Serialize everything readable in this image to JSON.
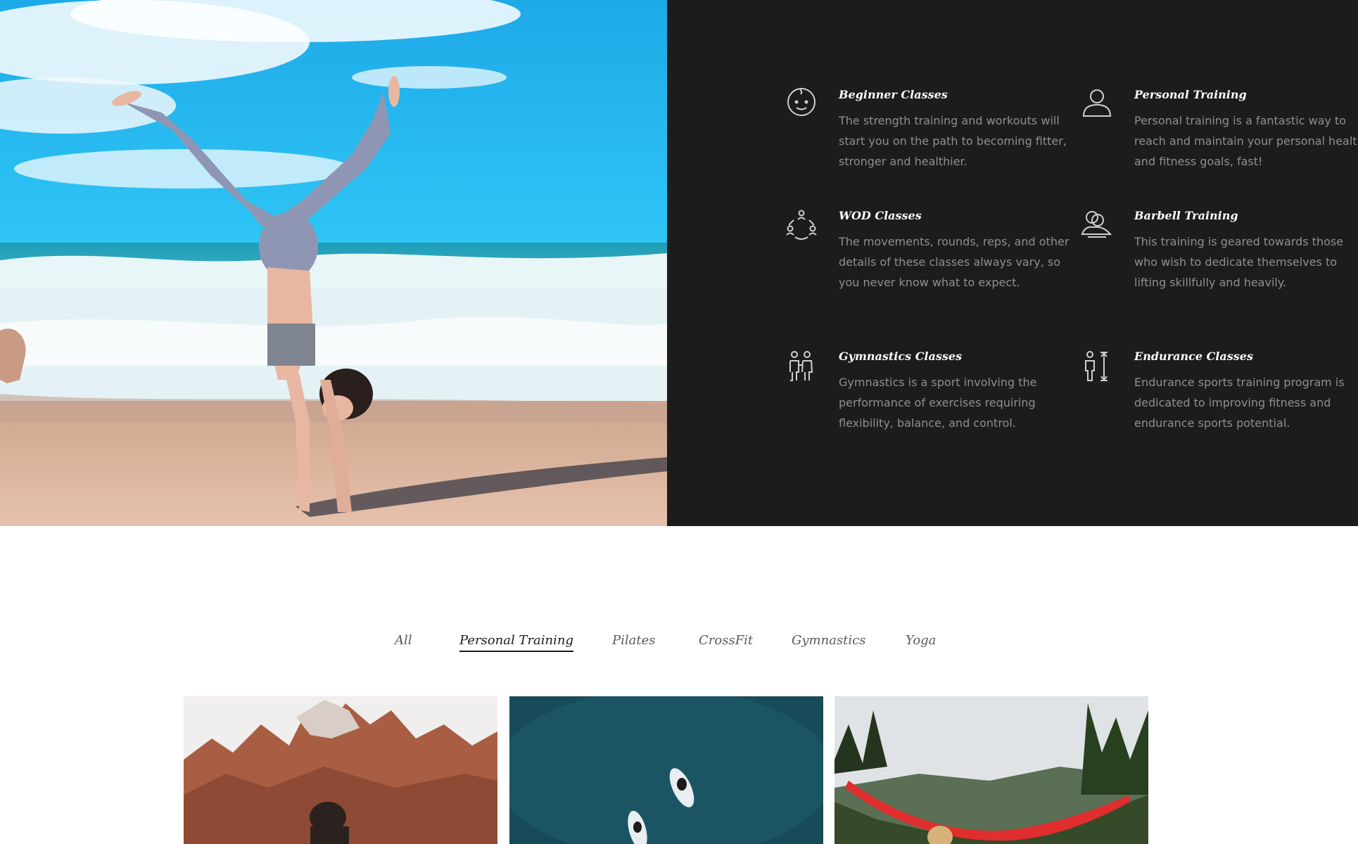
{
  "features": [
    {
      "icon": "baby-face-icon",
      "title": "Beginner Classes",
      "description": "The strength training and workouts will start you on the path to becoming fitter, stronger and healthier."
    },
    {
      "icon": "person-icon",
      "title": "Personal Training",
      "description": "Personal training is a fantastic way to reach and maintain your personal health and fitness goals, fast!"
    },
    {
      "icon": "group-circle-icon",
      "title": "WOD Classes",
      "description": "The movements, rounds, reps, and other details of these classes always vary, so you never know what to expect."
    },
    {
      "icon": "lifter-icon",
      "title": "Barbell Training",
      "description": "This training is geared towards those who wish to dedicate themselves to lifting skillfully and heavily."
    },
    {
      "icon": "gymnasts-icon",
      "title": "Gymnastics Classes",
      "description": "Gymnastics is a sport involving the performance of exercises requiring flexibility, balance, and control."
    },
    {
      "icon": "height-measure-icon",
      "title": "Endurance Classes",
      "description": "Endurance sports training program is dedicated to improving fitness and endurance sports potential."
    }
  ],
  "filters": {
    "all": "All",
    "personal_training": "Personal Training",
    "pilates": "Pilates",
    "crossfit": "CrossFit",
    "gymnastics": "Gymnastics",
    "yoga": "Yoga",
    "active": "Personal Training"
  },
  "colors": {
    "panel_bg": "#1c1c1c",
    "feature_title": "#ffffff",
    "feature_text": "#8f8f8f",
    "icon_stroke": "#cfcfcf",
    "tab_active": "#1b1b1b",
    "tab_inactive": "#5a5a5a"
  }
}
